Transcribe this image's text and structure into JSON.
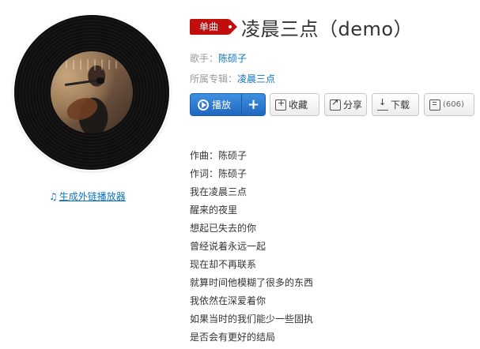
{
  "badge": {
    "label": "单曲"
  },
  "song": {
    "title": "凌晨三点（demo）"
  },
  "singer": {
    "label": "歌手：",
    "name": "陈硕子"
  },
  "album": {
    "label": "所属专辑：",
    "name": "凌晨三点"
  },
  "buttons": {
    "play": "播放",
    "add": "+",
    "favorite": "收藏",
    "share": "分享",
    "download": "下载",
    "comment_count": "(606)"
  },
  "external_player_link": "生成外链播放器",
  "icons": {
    "play": "play-circle-icon",
    "add": "plus-icon",
    "favorite": "favorite-add-icon",
    "share": "share-icon",
    "download": "download-icon",
    "comment": "comment-icon",
    "music_note": "music-note-icon"
  },
  "colors": {
    "badge_red": "#c10d0c",
    "link_blue": "#0c73c2",
    "play_blue": "#2a7ad2"
  },
  "lyrics": [
    "作曲：陈硕子",
    "作词：陈硕子",
    "我在凌晨三点",
    "醒来的夜里",
    "想起已失去的你",
    "曾经说着永远一起",
    "现在却不再联系",
    "就算时间他模糊了很多的东西",
    "我依然在深爱着你",
    "如果当时的我们能少一些固执",
    "是否会有更好的结局"
  ]
}
